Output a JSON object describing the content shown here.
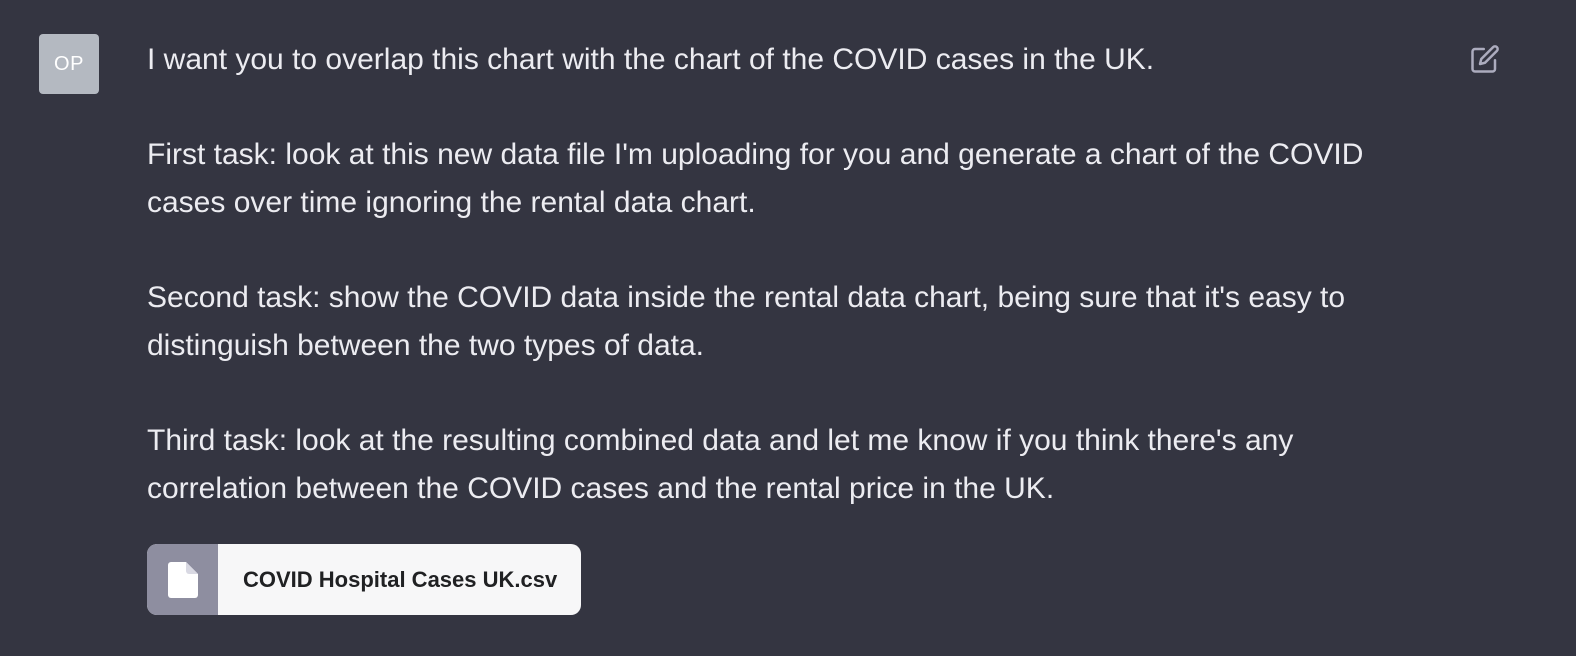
{
  "user": {
    "avatar_initials": "OP"
  },
  "message": {
    "paragraphs": [
      "I want you to overlap this chart with the chart of the COVID cases in the UK.",
      "First task: look at this new data file I'm uploading for you and generate a chart of the COVID cases over time ignoring the rental data chart.",
      "Second task: show the COVID data inside the rental data chart, being sure that it's easy to distinguish between the two types of data.",
      "Third task: look at the resulting combined data and let me know if you think there's any correlation between the COVID cases and the rental price in the UK."
    ],
    "attachment": {
      "filename": "COVID Hospital Cases UK.csv",
      "icon": "file-icon"
    },
    "edit_icon": "edit-icon"
  },
  "colors": {
    "background": "#343541",
    "text": "#ececf1",
    "avatar": "#b4b9c1",
    "attachment_bg": "#f7f7f8",
    "attachment_icon_bg": "#8e8ea0"
  }
}
